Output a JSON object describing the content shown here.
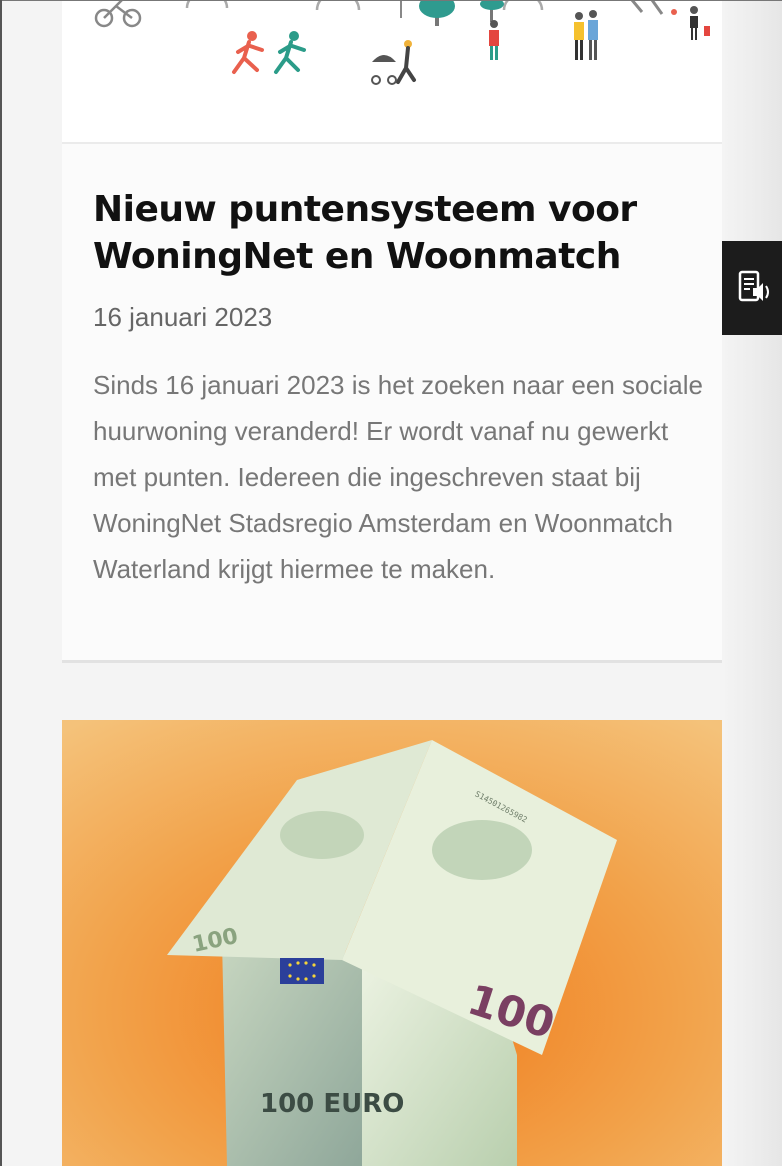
{
  "article": {
    "title": "Nieuw puntensysteem voor WoningNet en Woonmatch",
    "date": "16 januari 2023",
    "excerpt": "Sinds 16 januari 2023 is het zoeken naar een sociale huurwoning veranderd! Er wordt vanaf nu gewerkt met punten. Iedereen die ingeschreven staat bij WoningNet Stadsregio Amsterdam en Woonmatch Waterland krijgt hiermee te maken."
  },
  "second_card_image": {
    "banknote_text": "100",
    "banknote_text_bottom": "100 EURO",
    "serial": "S14501265982"
  },
  "side_tab": {
    "icon": "readspeaker-icon"
  },
  "colors": {
    "title": "#111111",
    "text_muted": "#777777",
    "image_bg": "#f1b45a",
    "side_tab_bg": "#1c1c1c"
  }
}
